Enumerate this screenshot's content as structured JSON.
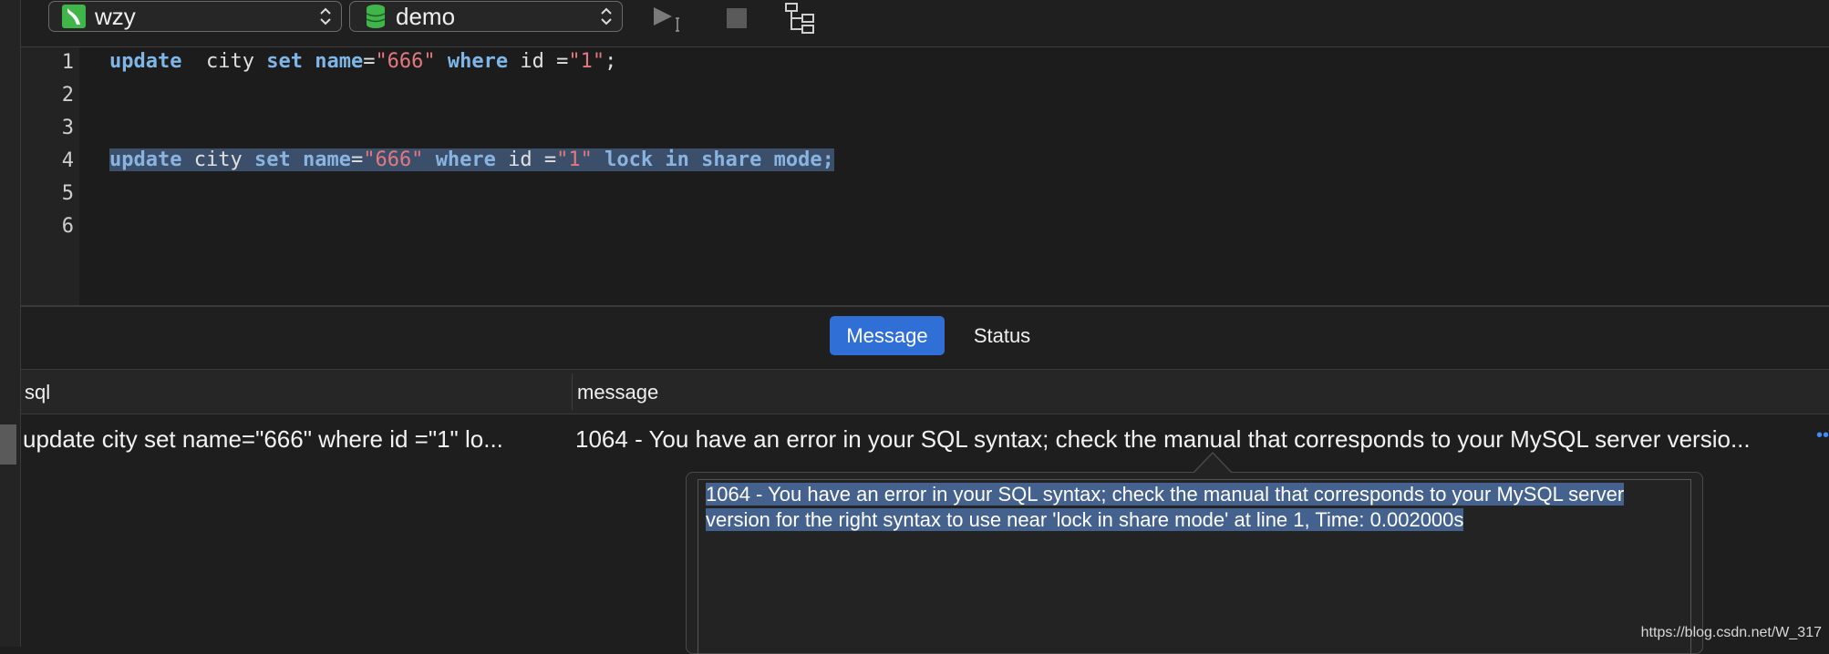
{
  "toolbar": {
    "connection": {
      "label": "wzy",
      "icon": "connection-icon"
    },
    "database": {
      "label": "demo",
      "icon": "database-icon"
    },
    "buttons": {
      "run": "run-icon",
      "stop": "stop-icon",
      "explain": "explain-icon"
    }
  },
  "editor": {
    "lines": [
      {
        "num": "1",
        "tokens": [
          {
            "t": "update",
            "k": "kw"
          },
          {
            "t": "  city ",
            "k": ""
          },
          {
            "t": "set",
            "k": "kw"
          },
          {
            "t": " ",
            "k": ""
          },
          {
            "t": "name",
            "k": "kw"
          },
          {
            "t": "=",
            "k": ""
          },
          {
            "t": "\"666\"",
            "k": "str"
          },
          {
            "t": " ",
            "k": ""
          },
          {
            "t": "where",
            "k": "kw"
          },
          {
            "t": " id =",
            "k": ""
          },
          {
            "t": "\"1\"",
            "k": "str"
          },
          {
            "t": ";",
            "k": ""
          }
        ]
      },
      {
        "num": "2",
        "tokens": []
      },
      {
        "num": "3",
        "tokens": []
      },
      {
        "num": "4",
        "selected": true,
        "tokens": [
          {
            "t": "update",
            "k": "kw"
          },
          {
            "t": " city ",
            "k": ""
          },
          {
            "t": "set",
            "k": "kw"
          },
          {
            "t": " ",
            "k": ""
          },
          {
            "t": "name",
            "k": "kw"
          },
          {
            "t": "=",
            "k": ""
          },
          {
            "t": "\"666\"",
            "k": "str"
          },
          {
            "t": " ",
            "k": ""
          },
          {
            "t": "where",
            "k": "kw"
          },
          {
            "t": " id =",
            "k": ""
          },
          {
            "t": "\"1\"",
            "k": "str"
          },
          {
            "t": " ",
            "k": ""
          },
          {
            "t": "lock in share mode;",
            "k": "kw"
          }
        ]
      },
      {
        "num": "5",
        "tokens": []
      },
      {
        "num": "6",
        "tokens": []
      }
    ]
  },
  "tabs": [
    {
      "label": "Message",
      "active": true
    },
    {
      "label": "Status",
      "active": false
    }
  ],
  "results": {
    "columns": [
      "sql",
      "message"
    ],
    "rows": [
      {
        "sql": "update city set name=\"666\" where id =\"1\" lo...",
        "message": "1064 - You have an error in your SQL syntax; check the manual that corresponds to your MySQL server versio..."
      }
    ]
  },
  "popover": {
    "text": "1064 - You have an error in your SQL syntax; check the manual that corresponds to your MySQL server version for the right syntax to use near 'lock in share mode' at line 1, Time: 0.002000s"
  },
  "watermark": "https://blog.csdn.net/W_317",
  "colors": {
    "accent": "#2f6fd6",
    "selection": "#3b4f6b",
    "keyword": "#7fb6e8",
    "string": "#e3797f"
  }
}
